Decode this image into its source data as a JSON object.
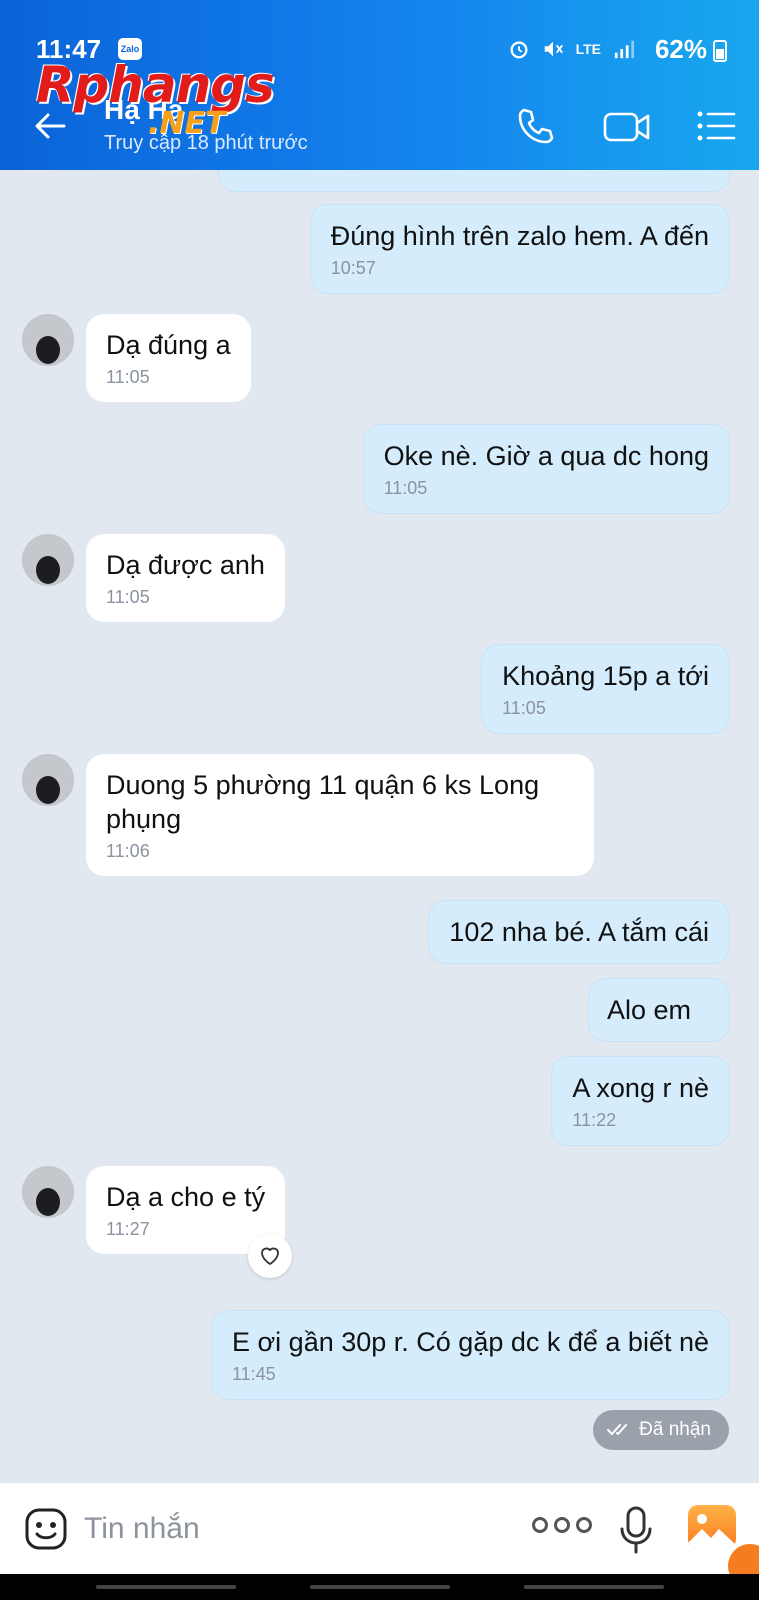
{
  "status_bar": {
    "time": "11:47",
    "app_badge": "Zalo",
    "network": "LTE",
    "battery": "62%"
  },
  "watermark": {
    "main": "Rphangs",
    "suffix": ".NET"
  },
  "header": {
    "contact_name": "Hạ Hạ",
    "contact_status": "Truy cập 18 phút trước"
  },
  "messages": [
    {
      "dir": "out",
      "text": "Đúng hình trên zalo hem. A đến",
      "time": "10:57"
    },
    {
      "dir": "in",
      "text": "Dạ đúng a",
      "time": "11:05"
    },
    {
      "dir": "out",
      "text": "Oke nè.  Giờ a qua dc hong",
      "time": "11:05"
    },
    {
      "dir": "in",
      "text": "Dạ được anh",
      "time": "11:05"
    },
    {
      "dir": "out",
      "text": "Khoảng 15p a tới",
      "time": "11:05"
    },
    {
      "dir": "in",
      "text": "Duong 5 phường 11 quận 6 ks Long phụng",
      "time": "11:06"
    },
    {
      "dir": "out",
      "text": "102 nha bé.  A tắm cái",
      "time": ""
    },
    {
      "dir": "out",
      "text": "Alo em",
      "time": ""
    },
    {
      "dir": "out",
      "text": "A xong r nè",
      "time": "11:22"
    },
    {
      "dir": "in",
      "text": "Dạ a cho e tý",
      "time": "11:27"
    },
    {
      "dir": "out",
      "text": "E ơi gần 30p r. Có gặp dc k để a biết nè",
      "time": "11:45"
    }
  ],
  "received_label": "Đã nhận",
  "input": {
    "placeholder": "Tin nhắn"
  },
  "colors": {
    "header_start": "#0a63d8",
    "header_end": "#18a8ee",
    "outgoing_bubble": "#d4ecfc",
    "incoming_bubble": "#ffffff",
    "chat_bg": "#e2e8f0"
  },
  "icons": [
    "back-arrow-icon",
    "phone-icon",
    "video-call-icon",
    "menu-icon",
    "heart-icon",
    "double-check-icon",
    "sticker-icon",
    "more-icon",
    "microphone-icon",
    "gallery-icon"
  ]
}
